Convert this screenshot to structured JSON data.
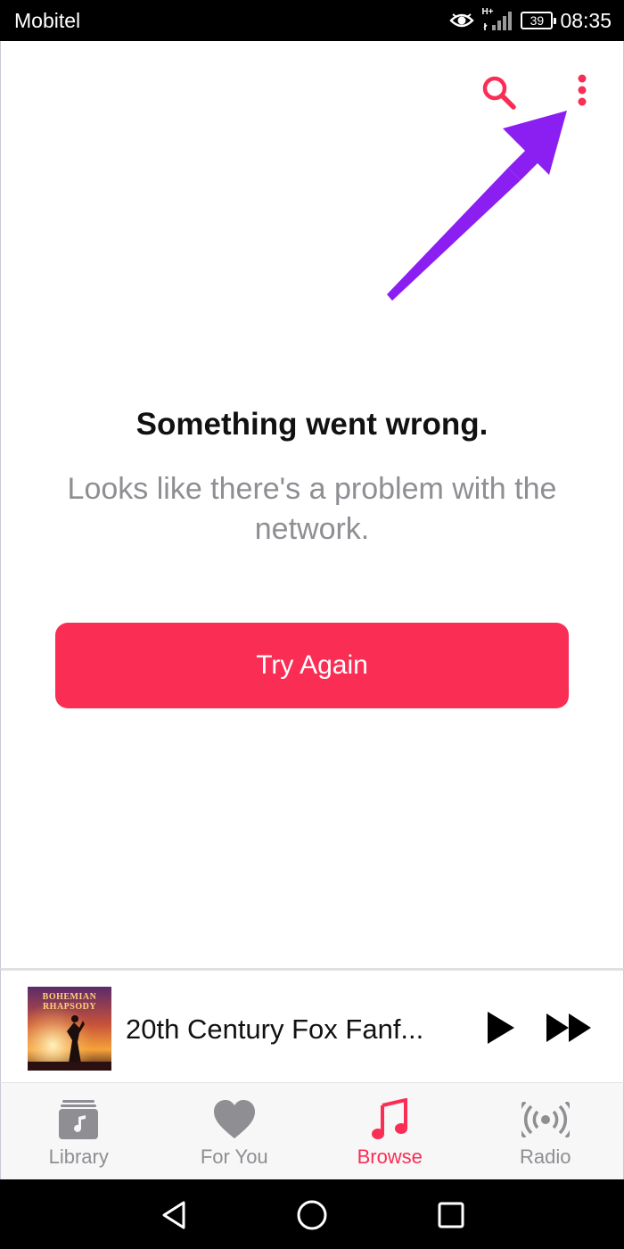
{
  "status_bar": {
    "carrier": "Mobitel",
    "network_type": "H+",
    "battery_level": "39",
    "time": "08:35",
    "icons": [
      "eye-icon",
      "signal-icon",
      "battery-icon"
    ]
  },
  "toolbar": {
    "icons": [
      "search-icon",
      "more-options-icon"
    ]
  },
  "annotation": {
    "arrow_color": "#8B1FF2"
  },
  "error": {
    "title": "Something went wrong.",
    "message": "Looks like there's a problem with the network."
  },
  "actions": {
    "try_again_label": "Try Again"
  },
  "mini_player": {
    "album_art_text": "BOHEMIAN RHAPSODY",
    "track_title": "20th Century Fox Fanf...",
    "controls": [
      "play-icon",
      "fast-forward-icon"
    ]
  },
  "tabs": [
    {
      "label": "Library",
      "icon": "library-icon",
      "active": false
    },
    {
      "label": "For You",
      "icon": "heart-icon",
      "active": false
    },
    {
      "label": "Browse",
      "icon": "music-note-icon",
      "active": true
    },
    {
      "label": "Radio",
      "icon": "radio-icon",
      "active": false
    }
  ],
  "nav_bar": {
    "icons": [
      "back-icon",
      "home-icon",
      "recents-icon"
    ]
  },
  "colors": {
    "accent": "#FA2D55",
    "secondary_text": "#8E8E93",
    "annotation_arrow": "#8B1FF2"
  }
}
